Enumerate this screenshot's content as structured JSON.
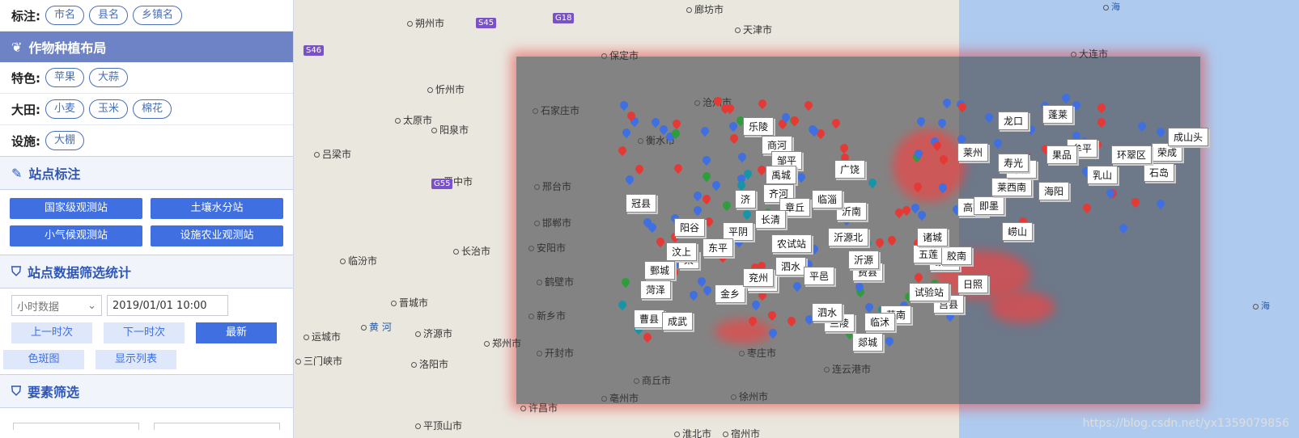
{
  "sidebar": {
    "label_row": {
      "label": "标注:",
      "items": [
        "市名",
        "县名",
        "乡镇名"
      ]
    },
    "crop_section": {
      "title": "作物种植布局"
    },
    "special_row": {
      "label": "特色:",
      "items": [
        "苹果",
        "大蒜"
      ]
    },
    "field_row": {
      "label": "大田:",
      "items": [
        "小麦",
        "玉米",
        "棉花"
      ]
    },
    "facility_row": {
      "label": "设施:",
      "items": [
        "大棚"
      ]
    },
    "station_section": {
      "title": "站点标注"
    },
    "station_buttons": [
      "国家级观测站",
      "土壤水分站",
      "小气候观测站",
      "设施农业观测站"
    ],
    "filter_section": {
      "title": "站点数据筛选统计"
    },
    "filter": {
      "type_value": "小时数据",
      "datetime_value": "2019/01/01 10:00"
    },
    "step_buttons": [
      "上一时次",
      "下一时次",
      "最新"
    ],
    "view_buttons": [
      "色斑图",
      "显示列表"
    ],
    "element_section": {
      "title": "要素筛选"
    }
  },
  "map": {
    "cities": [
      "朔州市",
      "天津市",
      "廊坊市",
      "保定市",
      "沧州市",
      "忻州市",
      "太原市",
      "石家庄市",
      "阳泉市",
      "衡水市",
      "吕梁市",
      "邢台市",
      "邯郸市",
      "晋中市",
      "长治市",
      "临汾市",
      "安阳市",
      "鹤壁市",
      "晋城市",
      "新乡市",
      "运城市",
      "济源市",
      "郑州市",
      "三门峡市",
      "洛阳市",
      "开封市",
      "商丘市",
      "徐州市",
      "连云港市",
      "亳州市",
      "淮北市",
      "宿州市",
      "许昌市",
      "平顶山市",
      "枣庄市",
      "大连市"
    ],
    "highways": [
      "S45",
      "G18",
      "S46",
      "G55"
    ],
    "sea_labels": [
      "海",
      "海"
    ],
    "river": "黄 河",
    "stations": [
      "乐陵",
      "商河",
      "邹平",
      "禹城",
      "齐河",
      "济",
      "章丘",
      "长清",
      "平阴",
      "东平",
      "梁",
      "汶上",
      "金乡",
      "微山",
      "兖州",
      "泗水",
      "平邑",
      "费县",
      "沂南",
      "沂源北",
      "沂源",
      "蒙阴",
      "莒县",
      "莒南",
      "临沭",
      "郯城",
      "兰陵",
      "日照",
      "五莲",
      "胶南",
      "诸城",
      "高密",
      "即墨",
      "崂山",
      "莱西南",
      "莱阳",
      "海阳",
      "乳山",
      "牟平",
      "荣成",
      "石岛",
      "环翠区",
      "成山头",
      "龙口",
      "蓬莱",
      "莱州",
      "果品",
      "冠县",
      "阳谷",
      "鄄城",
      "菏泽",
      "曹县",
      "成武",
      "农试站",
      "泗水",
      "广饶",
      "寿光",
      "临淄",
      "试验站"
    ],
    "watermark": "https://blog.csdn.net/yx1359079856"
  },
  "colors": {
    "accent": "#3f6fe0",
    "section_dark": "#6d83c5",
    "marker_red": "#e53935",
    "marker_blue": "#3f6fe0",
    "marker_green": "#2e9d3b",
    "marker_teal": "#1795a8"
  }
}
